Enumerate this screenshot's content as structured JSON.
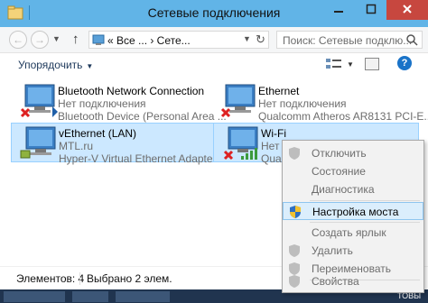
{
  "window": {
    "title": "Сетевые подключения"
  },
  "nav": {
    "address_text": "« Все ... › Сете...",
    "search_placeholder": "Поиск: Сетевые подклю..."
  },
  "toolbar": {
    "organize_label": "Упорядочить"
  },
  "connections": [
    {
      "name": "Bluetooth Network Connection",
      "status": "Нет подключения",
      "device": "Bluetooth Device (Personal Area ...",
      "state_icon": "red-x-icon",
      "selected": false
    },
    {
      "name": "Ethernet",
      "status": "Нет подключения",
      "device": "Qualcomm Atheros AR8131 PCI-E...",
      "state_icon": "red-x-icon",
      "selected": false
    },
    {
      "name": "vEthernet (LAN)",
      "status": "MTL.ru",
      "device": "Hyper-V Virtual Ethernet Adapter ...",
      "state_icon": "none",
      "selected": true
    },
    {
      "name": "Wi-Fi",
      "status": "Нет подключения",
      "device": "Qualcomm",
      "state_icon": "red-x-icon",
      "selected": true
    }
  ],
  "context_menu": {
    "items": [
      {
        "label": "Отключить",
        "enabled": false,
        "shield": true
      },
      {
        "label": "Состояние",
        "enabled": false,
        "shield": false
      },
      {
        "label": "Диагностика",
        "enabled": false,
        "shield": false
      },
      {
        "label": "Настройка моста",
        "enabled": true,
        "shield": true,
        "highlighted": true
      },
      {
        "label": "Создать ярлык",
        "enabled": false,
        "shield": false
      },
      {
        "label": "Удалить",
        "enabled": false,
        "shield": true
      },
      {
        "label": "Переименовать",
        "enabled": false,
        "shield": true
      },
      {
        "label": "Свойства",
        "enabled": false,
        "shield": true
      }
    ]
  },
  "status": {
    "items_count": "Элементов: 4",
    "selected_count": "Выбрано 2 элем."
  },
  "taskbar": {
    "text": "ТОВЫ"
  },
  "colors": {
    "titlebar": "#61b4e7",
    "close_button": "#c7473f",
    "selection": "#cce8ff",
    "menu_highlight": "#dbeefc"
  }
}
